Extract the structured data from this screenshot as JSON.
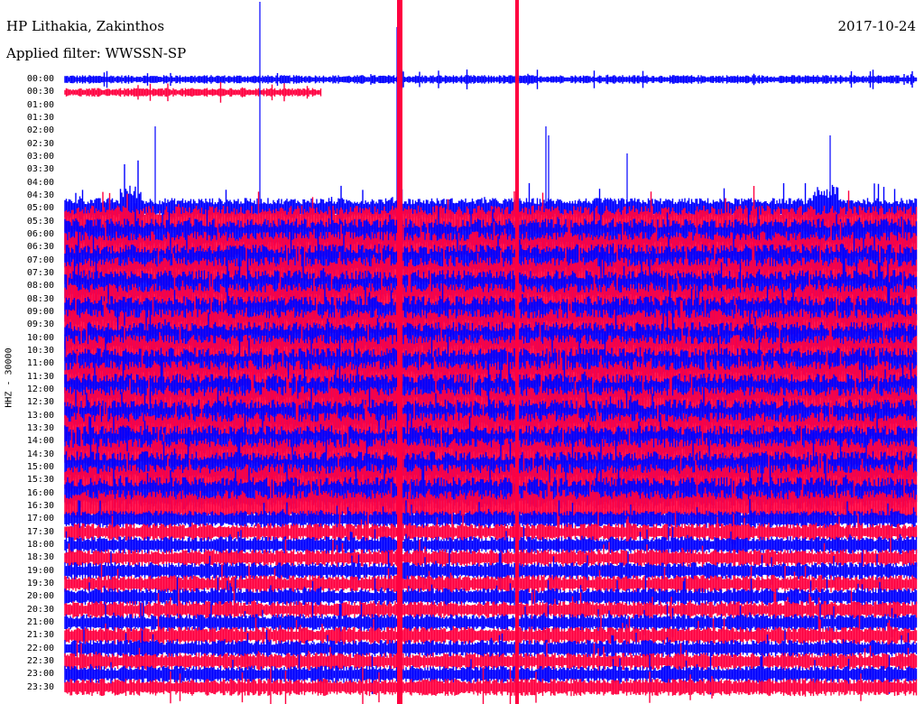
{
  "header": {
    "station": "HP Lithakia, Zakinthos",
    "filter": "Applied filter: WWSSN-SP",
    "date": "2017-10-24"
  },
  "channel_label": "HHZ - 30000",
  "row_labels": [
    "00:00",
    "00:30",
    "01:00",
    "01:30",
    "02:00",
    "02:30",
    "03:00",
    "03:30",
    "04:00",
    "04:30",
    "05:00",
    "05:30",
    "06:00",
    "06:30",
    "07:00",
    "07:30",
    "08:00",
    "08:30",
    "09:00",
    "09:30",
    "10:00",
    "10:30",
    "11:00",
    "11:30",
    "12:00",
    "12:30",
    "13:00",
    "13:30",
    "14:00",
    "14:30",
    "15:00",
    "15:30",
    "16:00",
    "16:30",
    "17:00",
    "17:30",
    "18:00",
    "18:30",
    "19:00",
    "19:30",
    "20:00",
    "20:30",
    "21:00",
    "21:30",
    "22:00",
    "22:30",
    "23:00",
    "23:30"
  ],
  "colors": {
    "trace_a": "#0000ff",
    "trace_b": "#ff0040",
    "background": "#ffffff"
  }
}
